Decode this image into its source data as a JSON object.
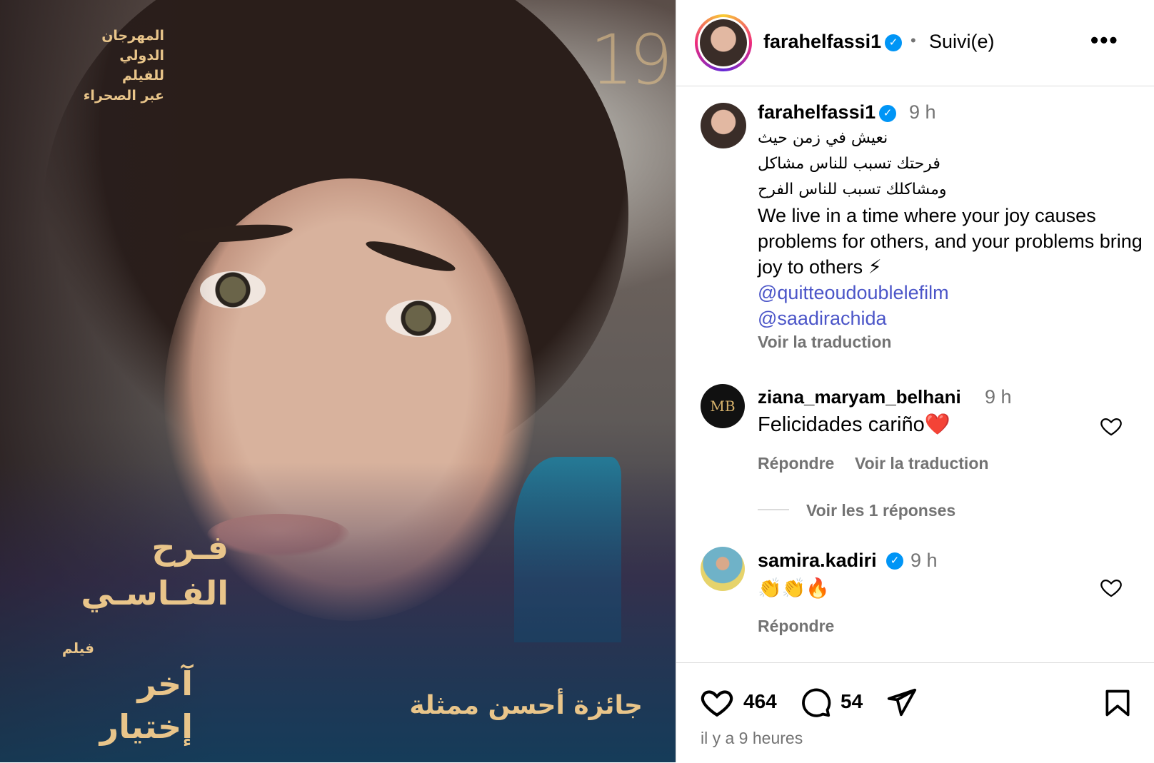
{
  "post_image": {
    "festival_lines": [
      "المهرجان",
      "الدولي",
      "للفيلم",
      "عبر الصحراء"
    ],
    "edition": "19",
    "actor_lines": [
      "فـرح",
      "الفـاسـي"
    ],
    "film_label": "فيلم",
    "film_title_lines": [
      "آخر",
      "إختيار"
    ],
    "award": "جائزة أحسن ممثلة"
  },
  "header": {
    "username": "farahelfassi1",
    "separator": "•",
    "follow_status": "Suivi(e)",
    "more_icon": "more-horizontal-icon"
  },
  "caption": {
    "username": "farahelfassi1",
    "time": "9 h",
    "arabic_lines": [
      "نعيش في زمن حيث",
      "فرحتك تسبب للناس مشاكل",
      "ومشاكلك تسبب للناس الفرح"
    ],
    "english": "We live in a time where your joy causes problems for others, and your problems bring joy to others ⚡",
    "mentions": [
      "@quitteoudoublelefilm",
      "@saadirachida"
    ],
    "translate": "Voir la traduction"
  },
  "comments": [
    {
      "username": "ziana_maryam_belhani",
      "time": "9 h",
      "text": "Felicidades cariño❤️",
      "reply": "Répondre",
      "translate": "Voir la traduction",
      "view_replies": "Voir les 1 réponses",
      "avatar_text": "MB"
    },
    {
      "username": "samira.kadiri",
      "time": "9 h",
      "text": "👏👏🔥",
      "reply": "Répondre"
    }
  ],
  "actions": {
    "likes": "464",
    "comments": "54",
    "time_ago": "il y a 9 heures"
  },
  "colors": {
    "verified": "#0095f6",
    "link": "#4b55c8",
    "muted": "#737373",
    "gold": "#e9c58a"
  }
}
